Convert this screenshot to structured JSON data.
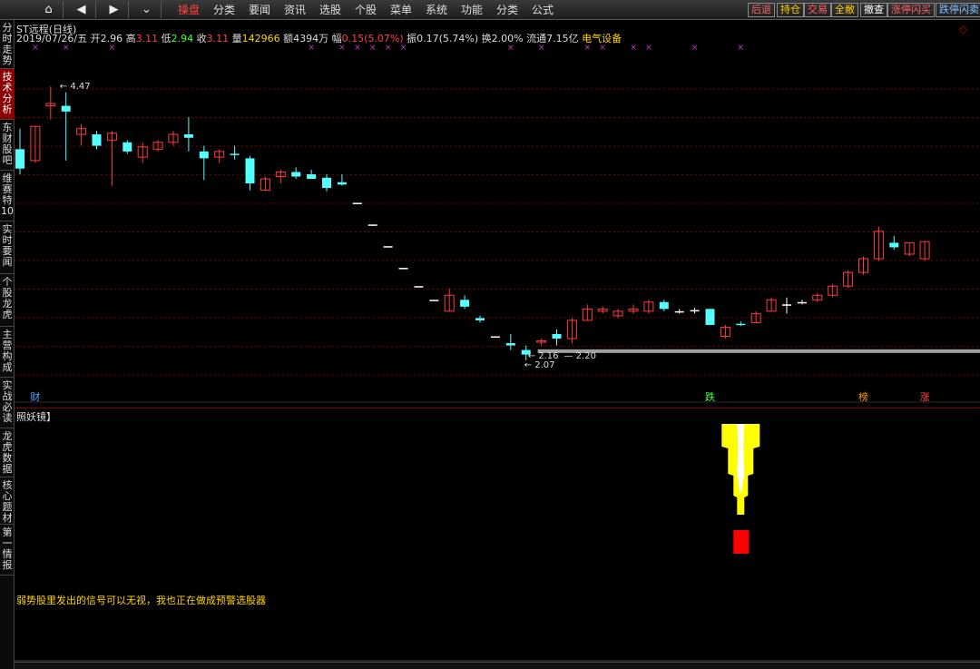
{
  "toolbar": {
    "nav": [
      "⌂",
      "◀",
      "▶",
      "⌄"
    ],
    "menus": [
      "操盘",
      "分类",
      "要闻",
      "资讯",
      "选股",
      "个股",
      "菜单",
      "系统",
      "功能",
      "分类",
      "公式"
    ],
    "active_menu": 0,
    "right_buttons": [
      {
        "label": "后退",
        "color": "#ff6060"
      },
      {
        "label": "持仓",
        "color": "#ffd400"
      },
      {
        "label": "交易",
        "color": "#ff6060"
      },
      {
        "label": "全敝",
        "color": "#ffd400"
      },
      {
        "label": "撤查",
        "color": "#ffffff"
      },
      {
        "label": "涨停闪买",
        "color": "#ff6060"
      },
      {
        "label": "跌停闪卖",
        "color": "#80c0ff"
      }
    ]
  },
  "sidebar": {
    "tabs": [
      "分时走势",
      "技术分析",
      "东财股吧",
      "维赛特10",
      "实时要闻",
      "个股龙虎",
      "主营构成",
      "实战必读",
      "龙虎数据",
      "核心题材",
      "第一情报"
    ],
    "active": 1
  },
  "header": {
    "title": "ST远程(日线)",
    "date": "2019/07/26/五",
    "open_label": "开",
    "open": "2.96",
    "high_label": "高",
    "high": "3.11",
    "low_label": "低",
    "low": "2.94",
    "close_label": "收",
    "close": "3.11",
    "vol_label": "量",
    "vol": "142966",
    "amt_label": "额",
    "amt": "4394万",
    "chg_label": "幅",
    "chg": "0.15(5.07%)",
    "amp_label": "振",
    "amp": "0.17(5.74%)",
    "turn_label": "换",
    "turn": "2.00%",
    "float_label": "流通",
    "float": "7.15亿",
    "sector": "电气设备"
  },
  "annotations": {
    "high_mark": "4.47",
    "low_mark": "2.07",
    "low_left": "2.16",
    "low_right": "2.20"
  },
  "event_tags": [
    {
      "label": "财",
      "color": "#4da6ff",
      "index": 1
    },
    {
      "label": "跌",
      "color": "#40ff40",
      "index": 45
    },
    {
      "label": "榜",
      "color": "#ff9900",
      "index": 55
    },
    {
      "label": "涨",
      "color": "#ff4040",
      "index": 59
    }
  ],
  "indicator": {
    "title": "照妖镜】"
  },
  "note": "弱势股里发出的信号可以无视，我也正在做成预警选股器",
  "colors": {
    "up": "#ff3b3b",
    "down": "#54ffff",
    "flat": "#ffffff",
    "grid": "#7a0000",
    "marker": "#d030d0",
    "support": "#a0a0a0"
  },
  "chart_data": {
    "type": "candlestick",
    "ylim": [
      1.95,
      4.75
    ],
    "candles": [
      {
        "o": 3.92,
        "h": 4.1,
        "l": 3.7,
        "c": 3.75
      },
      {
        "o": 3.82,
        "h": 4.12,
        "l": 3.8,
        "c": 4.12
      },
      {
        "o": 4.3,
        "h": 4.47,
        "l": 4.18,
        "c": 4.32
      },
      {
        "o": 4.3,
        "h": 4.42,
        "l": 3.82,
        "c": 4.25
      },
      {
        "o": 4.05,
        "h": 4.14,
        "l": 3.95,
        "c": 4.1
      },
      {
        "o": 4.05,
        "h": 4.08,
        "l": 3.92,
        "c": 3.95
      },
      {
        "o": 4.0,
        "h": 4.08,
        "l": 3.6,
        "c": 4.06
      },
      {
        "o": 3.98,
        "h": 4.0,
        "l": 3.88,
        "c": 3.9
      },
      {
        "o": 3.85,
        "h": 3.98,
        "l": 3.8,
        "c": 3.94
      },
      {
        "o": 3.92,
        "h": 4.0,
        "l": 3.9,
        "c": 3.98
      },
      {
        "o": 3.98,
        "h": 4.08,
        "l": 3.95,
        "c": 4.05
      },
      {
        "o": 4.05,
        "h": 4.2,
        "l": 3.9,
        "c": 4.02
      },
      {
        "o": 3.9,
        "h": 3.95,
        "l": 3.65,
        "c": 3.84
      },
      {
        "o": 3.85,
        "h": 3.92,
        "l": 3.8,
        "c": 3.9
      },
      {
        "o": 3.88,
        "h": 3.95,
        "l": 3.83,
        "c": 3.87
      },
      {
        "o": 3.84,
        "h": 3.86,
        "l": 3.56,
        "c": 3.62
      },
      {
        "o": 3.56,
        "h": 3.68,
        "l": 3.56,
        "c": 3.66
      },
      {
        "o": 3.68,
        "h": 3.74,
        "l": 3.62,
        "c": 3.72
      },
      {
        "o": 3.72,
        "h": 3.76,
        "l": 3.66,
        "c": 3.68
      },
      {
        "o": 3.7,
        "h": 3.74,
        "l": 3.66,
        "c": 3.66
      },
      {
        "o": 3.67,
        "h": 3.7,
        "l": 3.55,
        "c": 3.58
      },
      {
        "o": 3.63,
        "h": 3.7,
        "l": 3.6,
        "c": 3.61
      },
      {
        "o": 3.45,
        "h": 3.45,
        "l": 3.45,
        "c": 3.45
      },
      {
        "o": 3.26,
        "h": 3.26,
        "l": 3.26,
        "c": 3.26
      },
      {
        "o": 3.07,
        "h": 3.07,
        "l": 3.07,
        "c": 3.07
      },
      {
        "o": 2.88,
        "h": 2.88,
        "l": 2.88,
        "c": 2.88
      },
      {
        "o": 2.72,
        "h": 2.72,
        "l": 2.72,
        "c": 2.72
      },
      {
        "o": 2.6,
        "h": 2.6,
        "l": 2.6,
        "c": 2.6
      },
      {
        "o": 2.5,
        "h": 2.7,
        "l": 2.5,
        "c": 2.64
      },
      {
        "o": 2.6,
        "h": 2.64,
        "l": 2.52,
        "c": 2.54
      },
      {
        "o": 2.44,
        "h": 2.46,
        "l": 2.4,
        "c": 2.42
      },
      {
        "o": 2.28,
        "h": 2.28,
        "l": 2.28,
        "c": 2.28
      },
      {
        "o": 2.22,
        "h": 2.3,
        "l": 2.16,
        "c": 2.2
      },
      {
        "o": 2.16,
        "h": 2.2,
        "l": 2.07,
        "c": 2.12
      },
      {
        "o": 2.23,
        "h": 2.26,
        "l": 2.2,
        "c": 2.24
      },
      {
        "o": 2.3,
        "h": 2.34,
        "l": 2.2,
        "c": 2.26
      },
      {
        "o": 2.26,
        "h": 2.44,
        "l": 2.22,
        "c": 2.42
      },
      {
        "o": 2.42,
        "h": 2.56,
        "l": 2.42,
        "c": 2.52
      },
      {
        "o": 2.5,
        "h": 2.54,
        "l": 2.48,
        "c": 2.52
      },
      {
        "o": 2.46,
        "h": 2.52,
        "l": 2.44,
        "c": 2.5
      },
      {
        "o": 2.5,
        "h": 2.56,
        "l": 2.48,
        "c": 2.52
      },
      {
        "o": 2.5,
        "h": 2.6,
        "l": 2.48,
        "c": 2.58
      },
      {
        "o": 2.58,
        "h": 2.6,
        "l": 2.5,
        "c": 2.52
      },
      {
        "o": 2.5,
        "h": 2.52,
        "l": 2.48,
        "c": 2.5
      },
      {
        "o": 2.51,
        "h": 2.53,
        "l": 2.48,
        "c": 2.51
      },
      {
        "o": 2.52,
        "h": 2.52,
        "l": 2.38,
        "c": 2.38
      },
      {
        "o": 2.28,
        "h": 2.38,
        "l": 2.26,
        "c": 2.36
      },
      {
        "o": 2.39,
        "h": 2.41,
        "l": 2.37,
        "c": 2.38
      },
      {
        "o": 2.4,
        "h": 2.5,
        "l": 2.4,
        "c": 2.48
      },
      {
        "o": 2.5,
        "h": 2.62,
        "l": 2.5,
        "c": 2.6
      },
      {
        "o": 2.56,
        "h": 2.62,
        "l": 2.48,
        "c": 2.56
      },
      {
        "o": 2.58,
        "h": 2.6,
        "l": 2.56,
        "c": 2.58
      },
      {
        "o": 2.6,
        "h": 2.66,
        "l": 2.58,
        "c": 2.64
      },
      {
        "o": 2.64,
        "h": 2.74,
        "l": 2.62,
        "c": 2.72
      },
      {
        "o": 2.72,
        "h": 2.86,
        "l": 2.7,
        "c": 2.84
      },
      {
        "o": 2.84,
        "h": 2.98,
        "l": 2.82,
        "c": 2.96
      },
      {
        "o": 2.96,
        "h": 3.24,
        "l": 2.94,
        "c": 3.2
      },
      {
        "o": 3.1,
        "h": 3.16,
        "l": 3.04,
        "c": 3.06
      },
      {
        "o": 3.0,
        "h": 3.1,
        "l": 2.98,
        "c": 3.1
      },
      {
        "o": 2.96,
        "h": 3.11,
        "l": 2.94,
        "c": 3.11
      }
    ],
    "support_level": 2.15,
    "marker_indices": [
      1,
      3,
      6,
      19,
      21,
      22,
      23,
      24,
      25,
      32,
      34,
      37,
      38,
      40,
      41,
      44,
      47
    ]
  },
  "signal_indices": {
    "yellow": [
      47
    ],
    "red": [
      47
    ]
  }
}
